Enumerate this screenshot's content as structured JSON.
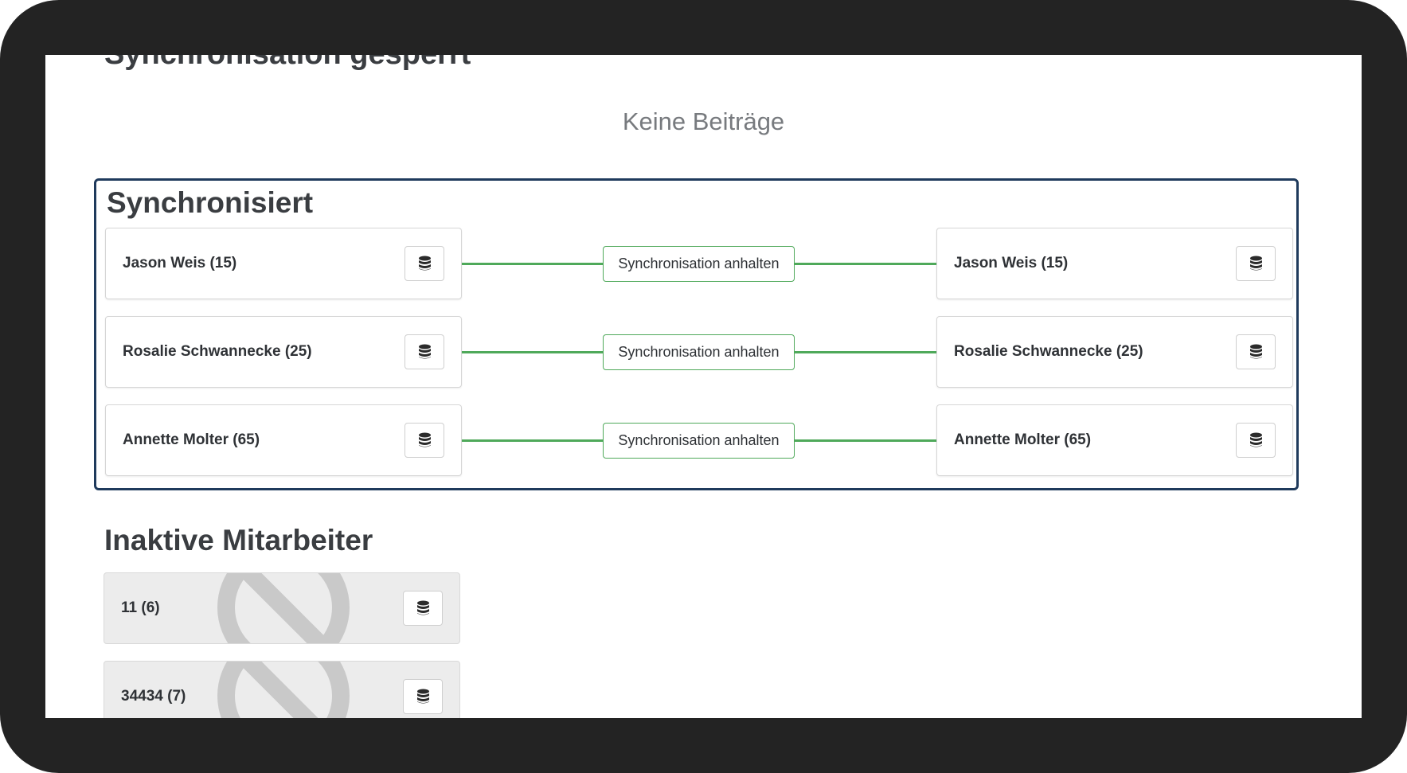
{
  "sections": {
    "locked": {
      "title": "Synchronisation gesperrt",
      "empty_text": "Keine Beiträge"
    },
    "synced": {
      "title": "Synchronisiert",
      "stop_label": "Synchronisation anhalten",
      "rows": [
        {
          "left": "Jason Weis (15)",
          "right": "Jason Weis (15)"
        },
        {
          "left": "Rosalie Schwannecke (25)",
          "right": "Rosalie Schwannecke (25)"
        },
        {
          "left": "Annette Molter (65)",
          "right": "Annette Molter (65)"
        }
      ]
    },
    "inactive": {
      "title": "Inaktive Mitarbeiter",
      "items": [
        {
          "label": "11 (6)"
        },
        {
          "label": "34434 (7)"
        }
      ]
    }
  },
  "icons": {
    "database": "database-icon",
    "banned": "ban-icon"
  },
  "colors": {
    "link_green": "#4fa95a",
    "highlight_border": "#1f3a5c",
    "inactive_bg": "#ececec",
    "frame": "#232323"
  }
}
